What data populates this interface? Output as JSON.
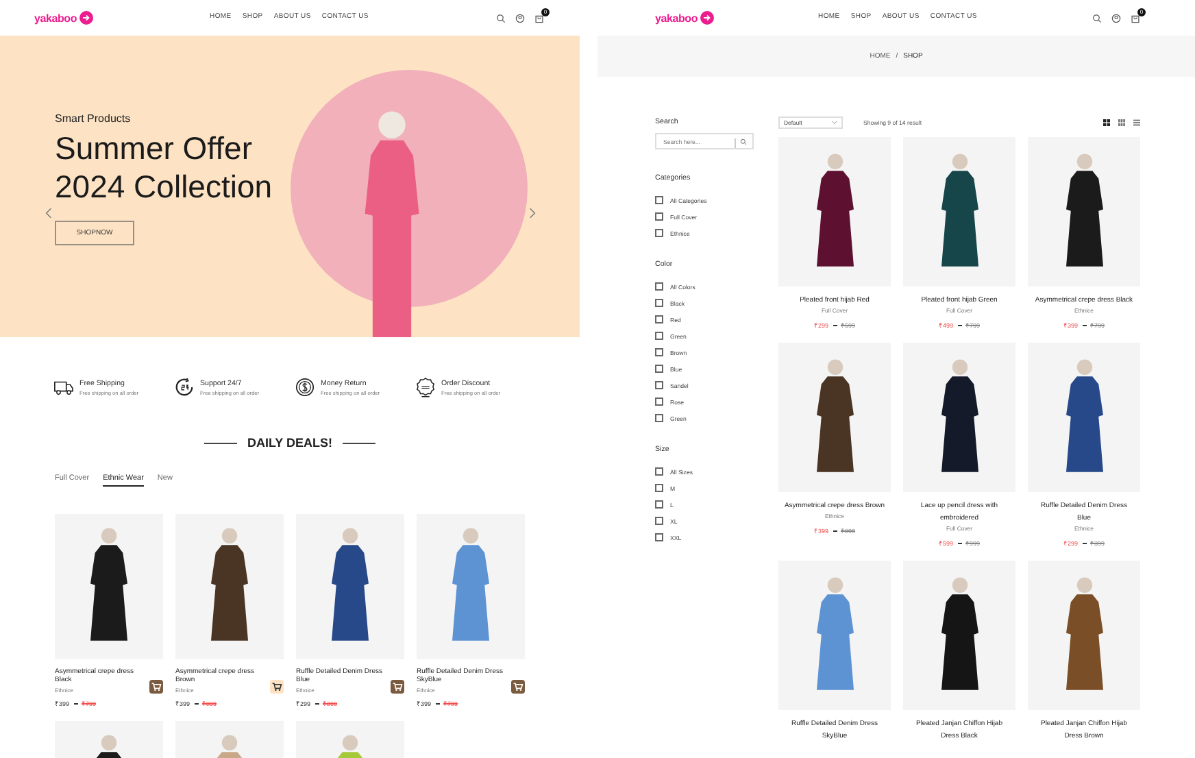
{
  "home_page": {
    "header": {
      "logo": "yakaboo",
      "nav": [
        "HOME",
        "SHOP",
        "ABOUT US",
        "CONTACT US"
      ],
      "cart_count": "0"
    },
    "hero": {
      "eyebrow": "Smart Products",
      "title_lines": [
        "Summer Offer",
        "2024 Collection"
      ],
      "button": "SHOPNOW"
    },
    "features": [
      {
        "kind": "truck",
        "title": "Free Shipping",
        "subtitle": "Free shipping on all order"
      },
      {
        "kind": "clock",
        "title": "Support 24/7",
        "subtitle": "Free shipping on all order"
      },
      {
        "kind": "coin",
        "title": "Money Return",
        "subtitle": "Free shipping on all order"
      },
      {
        "kind": "badge",
        "title": "Order Discount",
        "subtitle": "Free shipping on all order"
      }
    ],
    "deals": {
      "title": "DAILY DEALS!",
      "tabs": [
        {
          "label": "Full Cover",
          "selected": false
        },
        {
          "label": "Ethnic Wear",
          "selected": true
        },
        {
          "label": "New",
          "selected": false
        }
      ],
      "products": [
        {
          "name": "Asymmetrical crepe dress Black",
          "category": "Ethnice",
          "price": "₹399",
          "old_price": "₹799",
          "color": "#1b1b1b",
          "cart_highlighted": false
        },
        {
          "name": "Asymmetrical crepe dress Brown",
          "category": "Ethnice",
          "price": "₹399",
          "old_price": "₹899",
          "color": "#4a3424",
          "cart_highlighted": true
        },
        {
          "name": "Ruffle Detailed Denim Dress Blue",
          "category": "Ethnice",
          "price": "₹299",
          "old_price": "₹399",
          "color": "#27498a",
          "cart_highlighted": false
        },
        {
          "name": "Ruffle Detailed Denim Dress SkyBlue",
          "category": "Ethnice",
          "price": "₹399",
          "old_price": "₹799",
          "color": "#5d93d3",
          "cart_highlighted": false
        }
      ],
      "more_products": [
        {
          "color": "#1b1b1b"
        },
        {
          "color": "#c9a88a"
        },
        {
          "color": "#a6c93a"
        }
      ]
    }
  },
  "shop_page": {
    "header": {
      "logo": "yakaboo",
      "nav": [
        "HOME",
        "SHOP",
        "ABOUT US",
        "CONTACT US"
      ],
      "cart_count": "0"
    },
    "breadcrumb": {
      "items": [
        "HOME",
        "SHOP"
      ],
      "separator": "/"
    },
    "search": {
      "title": "Search",
      "placeholder": "Search here..."
    },
    "filters": [
      {
        "title": "Categories",
        "options": [
          {
            "label": "All Categories",
            "checked": false
          },
          {
            "label": "Full Cover",
            "checked": false
          },
          {
            "label": "Ethnice",
            "checked": false
          }
        ]
      },
      {
        "title": "Color",
        "options": [
          {
            "label": "All Colors",
            "checked": false
          },
          {
            "label": "Black",
            "checked": false
          },
          {
            "label": "Red",
            "checked": false
          },
          {
            "label": "Green",
            "checked": false
          },
          {
            "label": "Brown",
            "checked": false
          },
          {
            "label": "Blue",
            "checked": false
          },
          {
            "label": "Sandel",
            "checked": false
          },
          {
            "label": "Rose",
            "checked": false
          },
          {
            "label": "Green",
            "checked": false
          }
        ]
      },
      {
        "title": "Size",
        "options": [
          {
            "label": "All Sizes",
            "checked": false
          },
          {
            "label": "M",
            "checked": false
          },
          {
            "label": "L",
            "checked": false
          },
          {
            "label": "XL",
            "checked": false
          },
          {
            "label": "XXL",
            "checked": false
          }
        ]
      }
    ],
    "toolbar": {
      "sort": "Default",
      "result_text": "Showing 9 of 14 result",
      "views": [
        {
          "kind": "large-grid",
          "selected": true
        },
        {
          "kind": "small-grid",
          "selected": false
        },
        {
          "kind": "list",
          "selected": false
        }
      ]
    },
    "products": [
      {
        "name": "Pleated front hijab Red",
        "category": "Full Cover",
        "price": "₹299",
        "old_price": "₹599",
        "color": "#5e1030"
      },
      {
        "name": "Pleated front hijab Green",
        "category": "Full Cover",
        "price": "₹499",
        "old_price": "₹799",
        "color": "#17464a"
      },
      {
        "name": "Asymmetrical crepe dress Black",
        "category": "Ethnice",
        "price": "₹399",
        "old_price": "₹799",
        "color": "#1b1b1b"
      },
      {
        "name": "Asymmetrical crepe dress Brown",
        "category": "Ethnice",
        "price": "₹399",
        "old_price": "₹899",
        "color": "#4a3424"
      },
      {
        "name": "Lace up pencil dress with embroidered",
        "category": "Full Cover",
        "price": "₹599",
        "old_price": "₹999",
        "color": "#141a2a"
      },
      {
        "name": "Ruffle Detailed Denim Dress Blue",
        "category": "Ethnice",
        "price": "₹299",
        "old_price": "₹399",
        "color": "#27498a"
      },
      {
        "name": "Ruffle Detailed Denim Dress SkyBlue",
        "color": "#5d93d3"
      },
      {
        "name": "Pleated Janjan Chiffon Hijab Dress Black",
        "color": "#151515"
      },
      {
        "name": "Pleated Janjan Chiffon Hijab Dress Brown",
        "color": "#7a4e26"
      }
    ]
  }
}
